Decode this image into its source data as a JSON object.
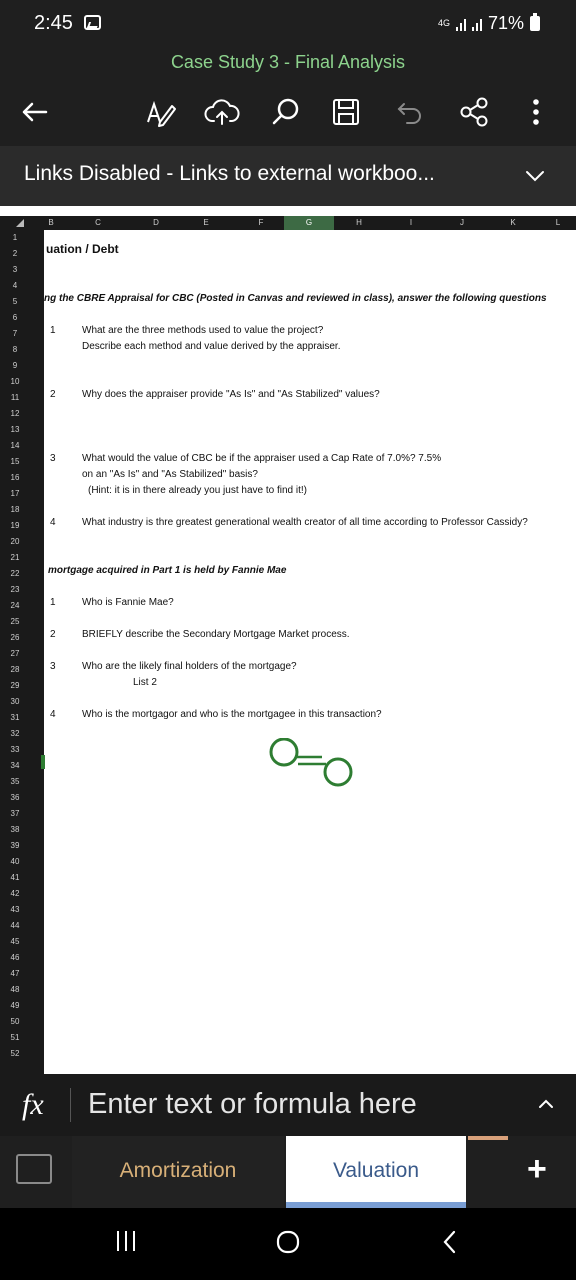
{
  "status": {
    "time": "2:45",
    "network": "4G",
    "battery": "71%"
  },
  "app": {
    "title": "Case Study 3 - Final Analysis"
  },
  "links_bar": {
    "message": "Links Disabled - Links to external workboo..."
  },
  "columns": [
    "B",
    "C",
    "D",
    "E",
    "F",
    "G",
    "H",
    "I",
    "J",
    "K",
    "L"
  ],
  "selected_column": "G",
  "rows": [
    "1",
    "2",
    "3",
    "4",
    "5",
    "6",
    "7",
    "8",
    "9",
    "10",
    "11",
    "12",
    "13",
    "14",
    "15",
    "16",
    "17",
    "18",
    "19",
    "20",
    "21",
    "22",
    "23",
    "24",
    "25",
    "26",
    "27",
    "28",
    "29",
    "30",
    "31",
    "32",
    "33",
    "34",
    "35",
    "36",
    "37",
    "38",
    "39",
    "40",
    "41",
    "42",
    "43",
    "44",
    "45",
    "46",
    "47",
    "48",
    "49",
    "50",
    "51",
    "52"
  ],
  "selected_row": "33",
  "sheet": {
    "r1": "uation / Debt",
    "r4": "ng the  CBRE Appraisal for CBC (Posted in Canvas and reviewed in class), answer the following questions",
    "q1_num": "1",
    "q1_line1": "What are the three methods used to value the project?",
    "q1_line2": "Describe each method and value derived by the appraiser.",
    "q2_num": "2",
    "q2_line1": "Why does the appraiser provide \"As Is\" and \"As Stabilized\" values?",
    "q3_num": "3",
    "q3_line1": "What would the value of CBC be if the appraiser used a Cap Rate of 7.0%?  7.5%",
    "q3_line2": "on an \"As Is\" and \"As Stabilized\" basis?",
    "q3_line3": "(Hint: it is in there already you just have to find it!)",
    "q4_num": "4",
    "q4_line1": "What industry is thre greatest generational wealth creator of all time according to Professor Cassidy?",
    "r21": "mortgage acquired in Part 1 is held by Fannie Mae",
    "p2q1_num": "1",
    "p2q1_line1": "Who is Fannie Mae?",
    "p2q2_num": "2",
    "p2q2_line1": "BRIEFLY describe the Secondary Mortgage Market process.",
    "p2q3_num": "3",
    "p2q3_line1": "Who are the likely final holders of the mortgage?",
    "p2q3_line2": "List 2",
    "p2q4_num": "4",
    "p2q4_line1": "Who is the mortgagor and who is the mortgagee in this transaction?"
  },
  "formula_bar": {
    "fx": "fx",
    "placeholder": "Enter text or formula here"
  },
  "tabs": [
    {
      "label": "Amortization"
    },
    {
      "label": "Valuation"
    }
  ],
  "add_sheet": "+",
  "colors": {
    "accent_green": "#8dd38d",
    "selection_green": "#2e7d32",
    "tab_active": "#7a9ed4"
  }
}
